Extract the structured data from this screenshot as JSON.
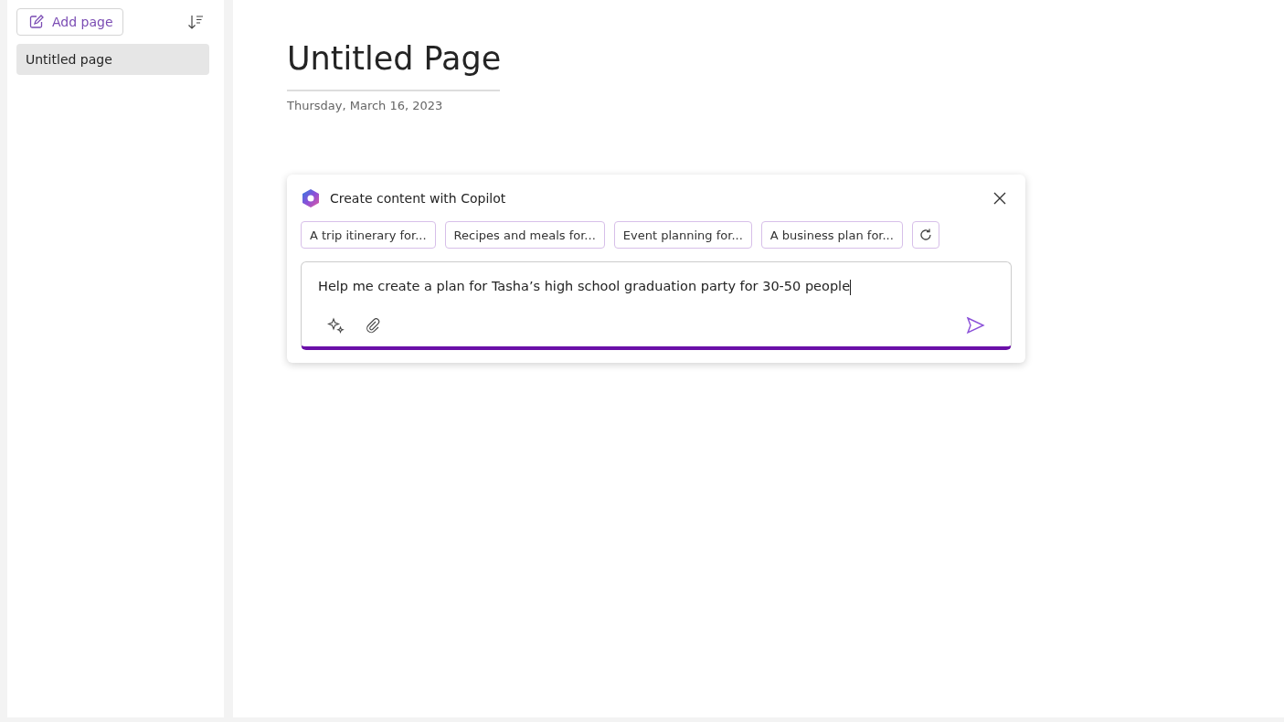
{
  "sidebar": {
    "add_button": "Add page",
    "pages": [
      {
        "label": "Untitled page",
        "selected": true
      }
    ]
  },
  "page": {
    "title": "Untitled Page",
    "date": "Thursday, March 16, 2023"
  },
  "copilot": {
    "title": "Create content with Copilot",
    "suggestions": [
      "A trip itinerary for...",
      "Recipes and meals for...",
      "Event planning for...",
      "A business plan for..."
    ],
    "prompt": "Help me create a plan for Tasha’s high school graduation party for 30-50 people"
  }
}
